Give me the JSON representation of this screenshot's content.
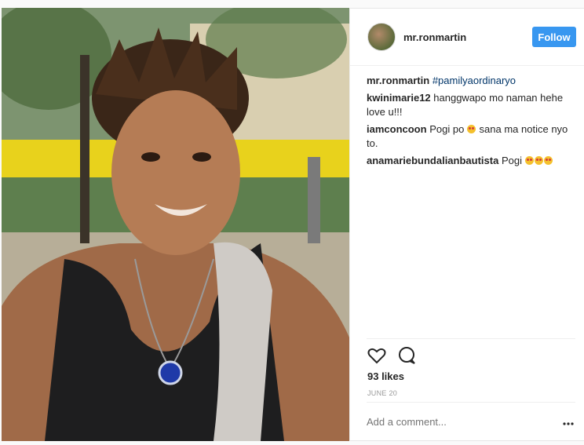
{
  "post": {
    "username": "mr.ronmartin",
    "follow_label": "Follow",
    "caption": {
      "user": "mr.ronmartin",
      "hashtag": "#pamilyaordinaryo"
    },
    "comments": [
      {
        "user": "kwinimarie12",
        "text": "hanggwapo mo naman hehe love u!!!"
      },
      {
        "user": "iamconcoon",
        "text_before": "Pogi po",
        "text_after": "sana ma notice nyo to."
      },
      {
        "user": "anamariebundalianbautista",
        "text": "Pogi"
      }
    ],
    "likes": "93 likes",
    "date": "JUNE 20",
    "comment_placeholder": "Add a comment..."
  },
  "icons": {
    "like": "heart-icon",
    "comment": "comment-bubble-icon",
    "more": "more-options-icon",
    "emoji": "heart-eyes-emoji"
  },
  "colors": {
    "follow_button": "#3897f0",
    "hashtag": "#003569",
    "muted_text": "#999999"
  }
}
